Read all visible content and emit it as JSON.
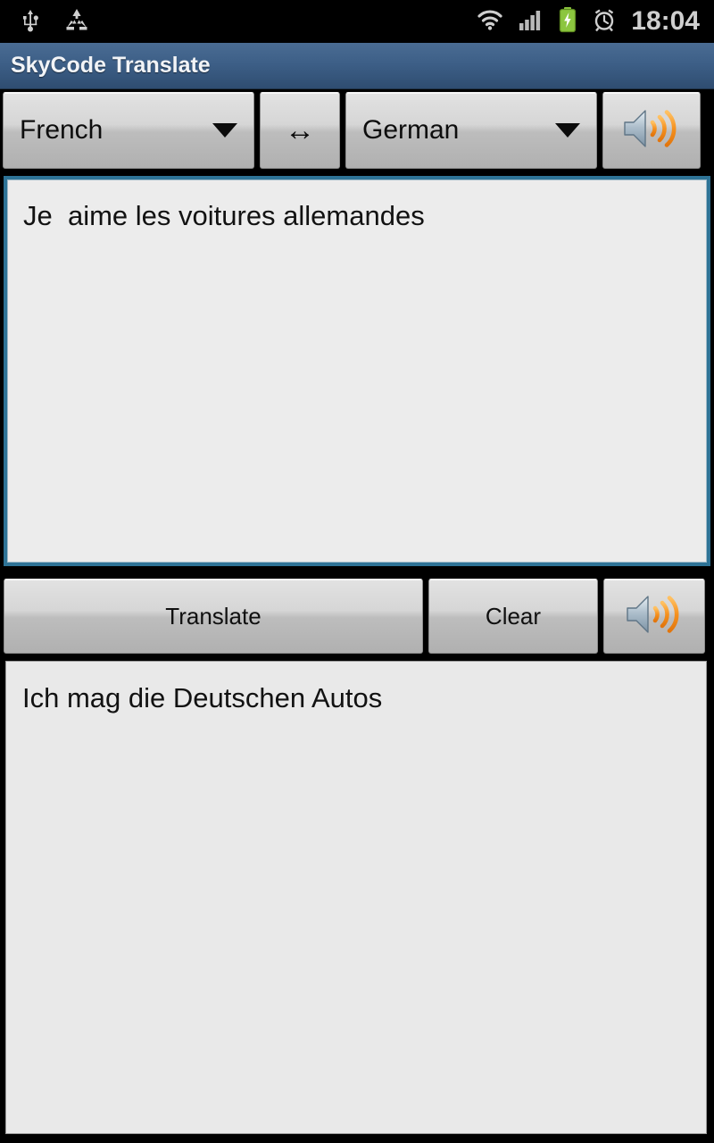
{
  "statusbar": {
    "left_icons": [
      {
        "name": "usb-icon",
        "label": "USB"
      },
      {
        "name": "recycle-icon",
        "label": "Recycle"
      }
    ],
    "right_icons": [
      {
        "name": "wifi-icon",
        "label": "Wi-Fi"
      },
      {
        "name": "signal-icon",
        "label": "Signal"
      },
      {
        "name": "battery-charging-icon",
        "label": "Battery charging"
      },
      {
        "name": "alarm-icon",
        "label": "Alarm"
      }
    ],
    "clock": "18:04"
  },
  "titlebar": {
    "title": "SkyCode Translate"
  },
  "language_row": {
    "source_language": "French",
    "target_language": "German",
    "swap_label": "↔",
    "speak_source_label": "speaker-icon"
  },
  "input": {
    "value": "Je  aime les voitures allemandes",
    "placeholder": ""
  },
  "actions": {
    "translate_label": "Translate",
    "clear_label": "Clear",
    "speak_output_label": "speaker-icon"
  },
  "output": {
    "value": "Ich mag die Deutschen Autos"
  },
  "colors": {
    "statusbar_bg": "#000000",
    "titlebar_top": "#4a6c93",
    "titlebar_bottom": "#2f4d71",
    "title_text": "#f2f4f7",
    "button_top": "#e2e2e2",
    "button_bottom": "#b0b0b0",
    "input_focus_border": "#2e7396",
    "input_bg": "#ececec",
    "output_bg": "#e9e9e9",
    "speaker_wave": "#f08a1e",
    "battery_green": "#8cc63f",
    "status_icon_gray": "#cfcfcf"
  }
}
